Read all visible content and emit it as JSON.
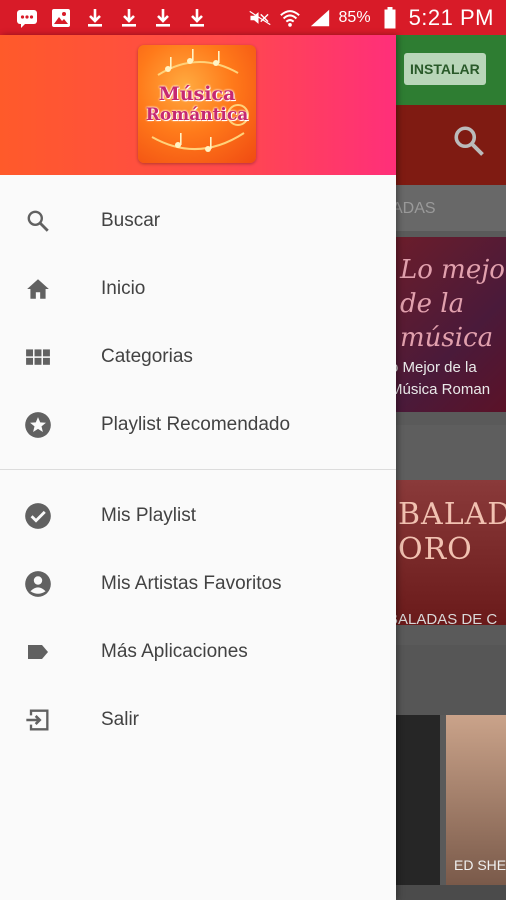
{
  "status_bar": {
    "icons": [
      "message-icon",
      "image-icon",
      "download-icon",
      "download-icon",
      "download-icon",
      "download-icon",
      "mute-icon",
      "wifi-icon",
      "signal-icon",
      "battery-icon"
    ],
    "battery_percent": "85%",
    "time": "5:21 PM",
    "color": "#d81b28"
  },
  "drawer": {
    "header_gradient": [
      "#ff5a2a",
      "#ff2f7a"
    ],
    "logo": {
      "line1": "Música",
      "line2": "Romántica"
    },
    "primary_items": [
      {
        "label": "Buscar",
        "icon": "search-icon"
      },
      {
        "label": "Inicio",
        "icon": "home-icon"
      },
      {
        "label": "Categorias",
        "icon": "grid-icon"
      },
      {
        "label": "Playlist Recomendado",
        "icon": "star-icon"
      }
    ],
    "secondary_items": [
      {
        "label": "Mis Playlist",
        "icon": "check-circle-icon"
      },
      {
        "label": "Mis Artistas Favoritos",
        "icon": "account-circle-icon"
      },
      {
        "label": "Más Aplicaciones",
        "icon": "label-icon"
      },
      {
        "label": "Salir",
        "icon": "exit-icon"
      }
    ]
  },
  "background_app": {
    "install_button": "INSTALAR",
    "tab_fragment": "ADAS",
    "card1_caption_line1": "o Mejor de la",
    "card1_caption_line2": "Música Roman",
    "card2_caption": "BALADAS DE C",
    "card4_caption": "ED SHE"
  }
}
